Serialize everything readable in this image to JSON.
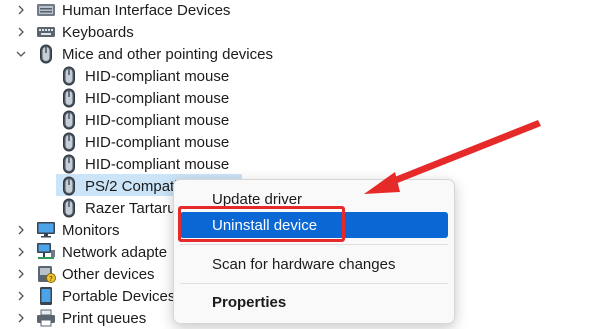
{
  "tree": [
    {
      "key": "hid",
      "label": "Human Interface Devices",
      "chevron": "›",
      "icon": "hid-icon"
    },
    {
      "key": "keyboards",
      "label": "Keyboards",
      "chevron": "›",
      "icon": "keyboard-icon"
    },
    {
      "key": "mice",
      "label": "Mice and other pointing devices",
      "chevron": "⌄",
      "icon": "mouse-icon"
    },
    {
      "key": "m1",
      "label": "HID-compliant mouse",
      "icon": "mouse-icon"
    },
    {
      "key": "m2",
      "label": "HID-compliant mouse",
      "icon": "mouse-icon"
    },
    {
      "key": "m3",
      "label": "HID-compliant mouse",
      "icon": "mouse-icon"
    },
    {
      "key": "m4",
      "label": "HID-compliant mouse",
      "icon": "mouse-icon"
    },
    {
      "key": "m5",
      "label": "HID-compliant mouse",
      "icon": "mouse-icon"
    },
    {
      "key": "ps2",
      "label": "PS/2 Compati",
      "icon": "mouse-icon"
    },
    {
      "key": "razer",
      "label": "Razer Tartaru",
      "icon": "mouse-icon"
    },
    {
      "key": "monitors",
      "label": "Monitors",
      "chevron": "›",
      "icon": "monitor-icon"
    },
    {
      "key": "network",
      "label": "Network adapte",
      "chevron": "›",
      "icon": "network-icon"
    },
    {
      "key": "other",
      "label": "Other devices",
      "chevron": "›",
      "icon": "other-devices-icon"
    },
    {
      "key": "portable",
      "label": "Portable Devices",
      "chevron": "›",
      "icon": "portable-device-icon"
    },
    {
      "key": "print",
      "label": "Print queues",
      "chevron": "›",
      "icon": "printer-icon"
    }
  ],
  "context_menu": {
    "update_driver": "Update driver",
    "uninstall_device": "Uninstall device",
    "scan_hardware": "Scan for hardware changes",
    "properties": "Properties"
  },
  "colors": {
    "selection": "#cce4f7",
    "menu_highlight": "#0a67d3",
    "annotation_red": "#e62a2a"
  }
}
